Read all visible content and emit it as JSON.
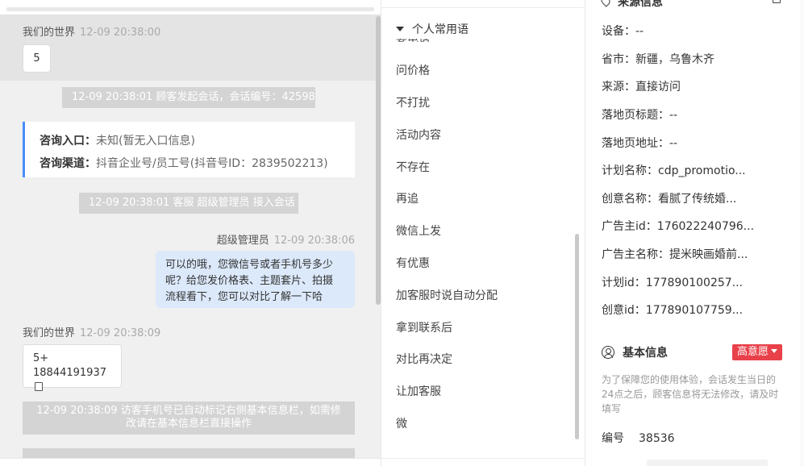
{
  "chat": {
    "msg1": {
      "sender": "我们的世界",
      "time": "12-09 20:38:00",
      "text": "5"
    },
    "sys1": "12-09 20:38:01 顾客发起会话，会话编号：42598",
    "consult": {
      "entry_label": "咨询入口：",
      "entry_value": "未知(暂无入口信息)",
      "channel_label": "咨询渠道：",
      "channel_value": "抖音企业号/员工号(抖音号ID：2839502213)"
    },
    "sys2": "12-09 20:38:01 客服 超级管理员 接入会话",
    "msg2": {
      "sender": "超级管理员",
      "time": "12-09 20:38:06",
      "line1": "可以的哦，您微信号或者手机号多少",
      "line2": "呢？给您发价格表、主题套片、拍摄",
      "line3": "流程看下，您可以对比了解一下哈"
    },
    "msg3": {
      "sender": "我们的世界",
      "time": "12-09 20:38:09",
      "line1": "5+",
      "line2": "18844191937"
    },
    "sys3": "12-09 20:38:09 访客手机号已自动标记右侧基本信息栏，如需修改请在基本信息栏直接操作"
  },
  "phrases": {
    "group_label": "个人常用语",
    "peek": "要电话",
    "items": [
      "问价格",
      "不打扰",
      "活动内容",
      "不存在",
      "再追",
      "微信上发",
      "有优惠",
      "加客服时说自动分配",
      "拿到联系后",
      "对比再决定",
      "让加客服",
      "微"
    ]
  },
  "info": {
    "source_title": "来源信息",
    "rows": [
      {
        "label": "设备：",
        "value": "--"
      },
      {
        "label": "省市：",
        "value": "新疆，乌鲁木齐"
      },
      {
        "label": "来源：",
        "value": "直接访问"
      },
      {
        "label": "落地页标题：",
        "value": "--"
      },
      {
        "label": "落地页地址：",
        "value": "--"
      },
      {
        "label": "计划名称：",
        "value": "cdp_promotio..."
      },
      {
        "label": "创意名称：",
        "value": "看腻了传统婚..."
      },
      {
        "label": "广告主id：",
        "value": "176022240796..."
      },
      {
        "label": "广告主名称：",
        "value": "提米映画婚前..."
      },
      {
        "label": "计划id：",
        "value": "177890100257..."
      },
      {
        "label": "创意id：",
        "value": "177890107759..."
      }
    ],
    "basic_title": "基本信息",
    "intent_badge": "高意愿",
    "notice": "为了保障您的使用体验，会话发生当日的24点之后，顾客信息将无法修改，请及时填写",
    "number_label": "编号",
    "number_value": "38536"
  },
  "colors": {
    "accent_blue": "#4a8df8",
    "outgoing_bubble": "#dce9fb",
    "system_msg": "#d4d4d4",
    "intent_red": "#e8414a"
  }
}
